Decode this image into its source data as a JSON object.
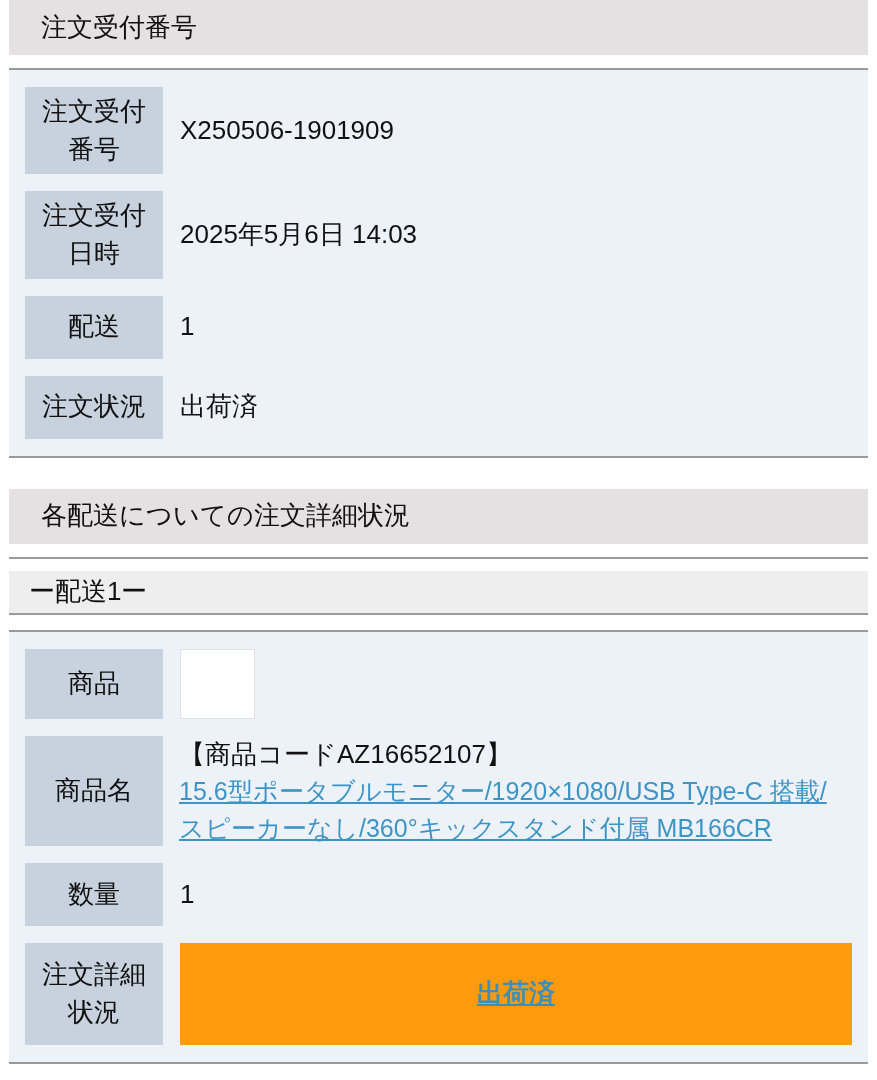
{
  "order_section": {
    "title": "注文受付番号",
    "rows": [
      {
        "kind": "text",
        "label": "注文受付番号",
        "value": "X250506-1901909"
      },
      {
        "kind": "text",
        "label": "注文受付日時",
        "value": "2025年5月6日 14:03"
      },
      {
        "kind": "text",
        "label": "配送",
        "value": "1"
      },
      {
        "kind": "text",
        "label": "注文状況",
        "value": "出荷済"
      }
    ]
  },
  "detail_section": {
    "title": "各配送についての注文詳細状況",
    "shipments": [
      {
        "title": "ー配送1ー",
        "rows": [
          {
            "kind": "image",
            "label": "商品"
          },
          {
            "kind": "product",
            "label": "商品名",
            "code": "【商品コードAZ16652107】",
            "link": "15.6型ポータブルモニター/1920×1080/USB Type-C 搭載/スピーカーなし/360°キックスタンド付属 MB166CR"
          },
          {
            "kind": "text",
            "label": "数量",
            "value": "1"
          },
          {
            "kind": "status",
            "label": "注文詳細状況",
            "value": "出荷済"
          }
        ]
      }
    ]
  }
}
